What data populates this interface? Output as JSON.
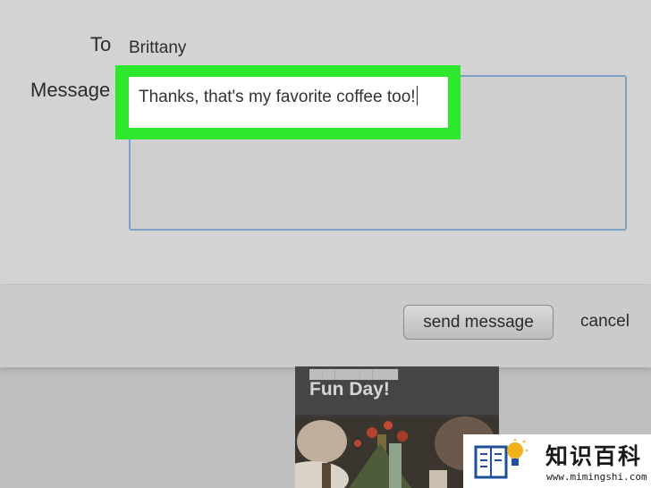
{
  "compose": {
    "to_label": "To",
    "to_value": "Brittany",
    "message_label": "Message",
    "message_value": "Thanks, that's my favorite coffee too!"
  },
  "actions": {
    "send_label": "send message",
    "cancel_label": "cancel"
  },
  "card": {
    "title": "Fun Day!"
  },
  "watermark": {
    "title": "知识百科",
    "url": "www.mimingshi.com"
  },
  "colors": {
    "highlight": "#2ee82e",
    "textarea_border": "#7ea1c7",
    "dialog_background": "#d3d3d3"
  }
}
